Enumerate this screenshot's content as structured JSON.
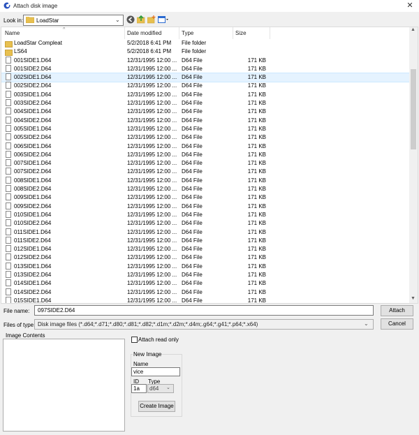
{
  "window": {
    "title": "Attach disk image",
    "close_glyph": "✕"
  },
  "lookin": {
    "label": "Look in:",
    "value": "LoadStar"
  },
  "toolbar": {
    "icons": [
      "back-icon",
      "up-folder-icon",
      "new-folder-icon",
      "view-menu-icon"
    ]
  },
  "columns": {
    "name": "Name",
    "date": "Date modified",
    "type": "Type",
    "size": "Size"
  },
  "files": [
    {
      "name": "LoadStar Compleat",
      "date": "5/2/2018 6:41 PM",
      "type": "File folder",
      "size": "",
      "icon": "folder-icon"
    },
    {
      "name": "LS64",
      "date": "5/2/2018 6:41 PM",
      "type": "File folder",
      "size": "",
      "icon": "folder-icon"
    },
    {
      "name": "001SIDE1.D64",
      "date": "12/31/1995 12:00 ...",
      "type": "D64 File",
      "size": "171 KB",
      "icon": "file-icon"
    },
    {
      "name": "001SIDE2.D64",
      "date": "12/31/1995 12:00 ...",
      "type": "D64 File",
      "size": "171 KB",
      "icon": "file-icon"
    },
    {
      "name": "002SIDE1.D64",
      "date": "12/31/1995 12:00 ...",
      "type": "D64 File",
      "size": "171 KB",
      "icon": "file-icon",
      "selected": true
    },
    {
      "name": "002SIDE2.D64",
      "date": "12/31/1995 12:00 ...",
      "type": "D64 File",
      "size": "171 KB",
      "icon": "file-icon"
    },
    {
      "name": "003SIDE1.D64",
      "date": "12/31/1995 12:00 ...",
      "type": "D64 File",
      "size": "171 KB",
      "icon": "file-icon"
    },
    {
      "name": "003SIDE2.D64",
      "date": "12/31/1995 12:00 ...",
      "type": "D64 File",
      "size": "171 KB",
      "icon": "file-icon"
    },
    {
      "name": "004SIDE1.D64",
      "date": "12/31/1995 12:00 ...",
      "type": "D64 File",
      "size": "171 KB",
      "icon": "file-icon"
    },
    {
      "name": "004SIDE2.D64",
      "date": "12/31/1995 12:00 ...",
      "type": "D64 File",
      "size": "171 KB",
      "icon": "file-icon"
    },
    {
      "name": "005SIDE1.D64",
      "date": "12/31/1995 12:00 ...",
      "type": "D64 File",
      "size": "171 KB",
      "icon": "file-icon"
    },
    {
      "name": "005SIDE2.D64",
      "date": "12/31/1995 12:00 ...",
      "type": "D64 File",
      "size": "171 KB",
      "icon": "file-icon"
    },
    {
      "name": "006SIDE1.D64",
      "date": "12/31/1995 12:00 ...",
      "type": "D64 File",
      "size": "171 KB",
      "icon": "file-icon"
    },
    {
      "name": "006SIDE2.D64",
      "date": "12/31/1995 12:00 ...",
      "type": "D64 File",
      "size": "171 KB",
      "icon": "file-icon"
    },
    {
      "name": "007SIDE1.D64",
      "date": "12/31/1995 12:00 ...",
      "type": "D64 File",
      "size": "171 KB",
      "icon": "file-icon"
    },
    {
      "name": "007SIDE2.D64",
      "date": "12/31/1995 12:00 ...",
      "type": "D64 File",
      "size": "171 KB",
      "icon": "file-icon"
    },
    {
      "name": "008SIDE1.D64",
      "date": "12/31/1995 12:00 ...",
      "type": "D64 File",
      "size": "171 KB",
      "icon": "file-icon"
    },
    {
      "name": "008SIDE2.D64",
      "date": "12/31/1995 12:00 ...",
      "type": "D64 File",
      "size": "171 KB",
      "icon": "file-icon"
    },
    {
      "name": "009SIDE1.D64",
      "date": "12/31/1995 12:00 ...",
      "type": "D64 File",
      "size": "171 KB",
      "icon": "file-icon"
    },
    {
      "name": "009SIDE2.D64",
      "date": "12/31/1995 12:00 ...",
      "type": "D64 File",
      "size": "171 KB",
      "icon": "file-icon"
    },
    {
      "name": "010SIDE1.D64",
      "date": "12/31/1995 12:00 ...",
      "type": "D64 File",
      "size": "171 KB",
      "icon": "file-icon"
    },
    {
      "name": "010SIDE2.D64",
      "date": "12/31/1995 12:00 ...",
      "type": "D64 File",
      "size": "171 KB",
      "icon": "file-icon"
    },
    {
      "name": "011SIDE1.D64",
      "date": "12/31/1995 12:00 ...",
      "type": "D64 File",
      "size": "171 KB",
      "icon": "file-icon"
    },
    {
      "name": "011SIDE2.D64",
      "date": "12/31/1995 12:00 ...",
      "type": "D64 File",
      "size": "171 KB",
      "icon": "file-icon"
    },
    {
      "name": "012SIDE1.D64",
      "date": "12/31/1995 12:00 ...",
      "type": "D64 File",
      "size": "171 KB",
      "icon": "file-icon"
    },
    {
      "name": "012SIDE2.D64",
      "date": "12/31/1995 12:00 ...",
      "type": "D64 File",
      "size": "171 KB",
      "icon": "file-icon"
    },
    {
      "name": "013SIDE1.D64",
      "date": "12/31/1995 12:00 ...",
      "type": "D64 File",
      "size": "171 KB",
      "icon": "file-icon"
    },
    {
      "name": "013SIDE2.D64",
      "date": "12/31/1995 12:00 ...",
      "type": "D64 File",
      "size": "171 KB",
      "icon": "file-icon"
    },
    {
      "name": "014SIDE1.D64",
      "date": "12/31/1995 12:00 ...",
      "type": "D64 File",
      "size": "171 KB",
      "icon": "file-icon"
    },
    {
      "name": "014SIDE2.D64",
      "date": "12/31/1995 12:00 ...",
      "type": "D64 File",
      "size": "171 KB",
      "icon": "file-icon"
    },
    {
      "name": "015SIDE1.D64",
      "date": "12/31/1995 12:00 ...",
      "type": "D64 File",
      "size": "171 KB",
      "icon": "file-icon"
    }
  ],
  "file_name": {
    "label": "File name:",
    "value": "097SIDE2.D64"
  },
  "file_type": {
    "label": "Files of type:",
    "value": "Disk image files (*.d64;*.d71;*.d80;*.d81;*.d82;*.d1m;*.d2m;*.d4m;.g64;*.g41;*.p64;*.x64)"
  },
  "buttons": {
    "attach": "Attach",
    "cancel": "Cancel",
    "create": "Create Image"
  },
  "image_contents": {
    "label": "Image Contents"
  },
  "attach_read_only": {
    "label": "Attach read only",
    "checked": false
  },
  "new_image": {
    "group_label": "New Image",
    "name_label": "Name",
    "name_value": "vice",
    "id_label": "ID",
    "id_value": "1a",
    "type_label": "Type",
    "type_value": "d64"
  },
  "colors": {
    "accent": "#2a52be",
    "folder": "#e8c04f",
    "selection": "#e5f3ff"
  }
}
